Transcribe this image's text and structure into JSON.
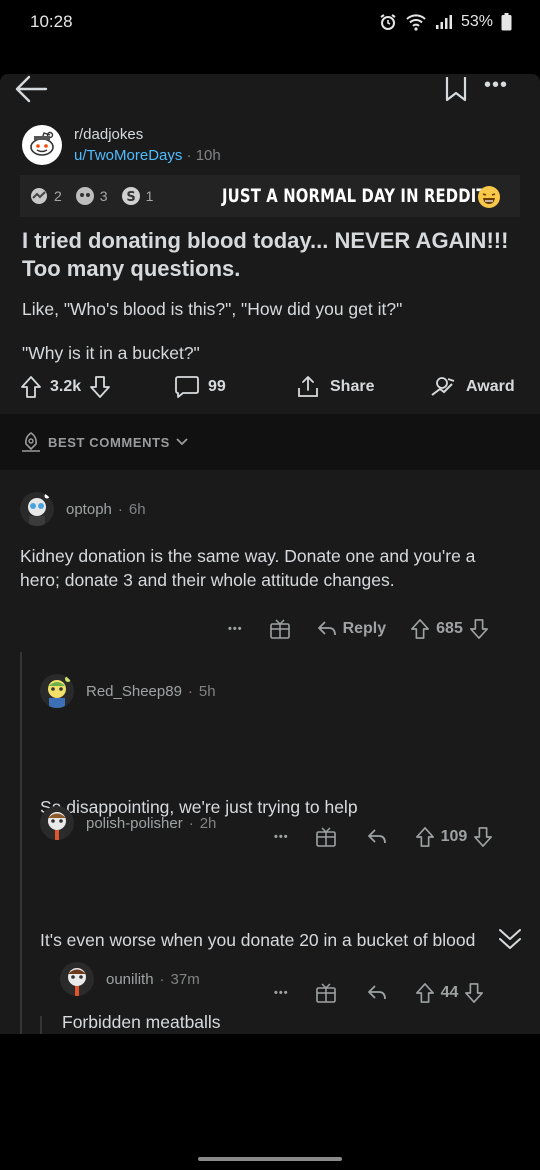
{
  "status_bar": {
    "time": "10:28",
    "battery": "53%"
  },
  "post": {
    "subreddit": "r/dadjokes",
    "author": "u/TwoMoreDays",
    "age": "10h",
    "awards": [
      {
        "icon": "wholesome-award-icon",
        "count": "2"
      },
      {
        "icon": "helpful-award-icon",
        "count": "3"
      },
      {
        "icon": "silver-award-icon",
        "count": "1"
      }
    ],
    "overlay_caption": "JUST A NORMAL DAY IN REDDIT",
    "title": "I tried donating blood today... NEVER AGAIN!!! Too many questions.",
    "body": [
      "Like, \"Who's blood is this?\", \"How did you get it?\"",
      "\"Why is it in a bucket?\""
    ],
    "votes": "3.2k",
    "comments": "99",
    "share_label": "Share",
    "award_label": "Award"
  },
  "sort": {
    "label": "BEST COMMENTS"
  },
  "comments": [
    {
      "user": "optoph",
      "age": "6h",
      "text": "Kidney donation is the same way.  Donate one and you're a hero; donate 3 and their whole attitude changes.",
      "reply_label": "Reply",
      "score": "685"
    },
    {
      "user": "Red_Sheep89",
      "age": "5h",
      "text": "So disappointing, we're just trying to help",
      "score": "109"
    },
    {
      "user": "polish-polisher",
      "age": "2h",
      "text": "It's even worse when you donate 20 in a bucket of blood",
      "score": "44"
    },
    {
      "user": "ounilith",
      "age": "37m",
      "text": "Forbidden meatballs"
    }
  ],
  "dot_sep": "·",
  "more_dots": "•••"
}
